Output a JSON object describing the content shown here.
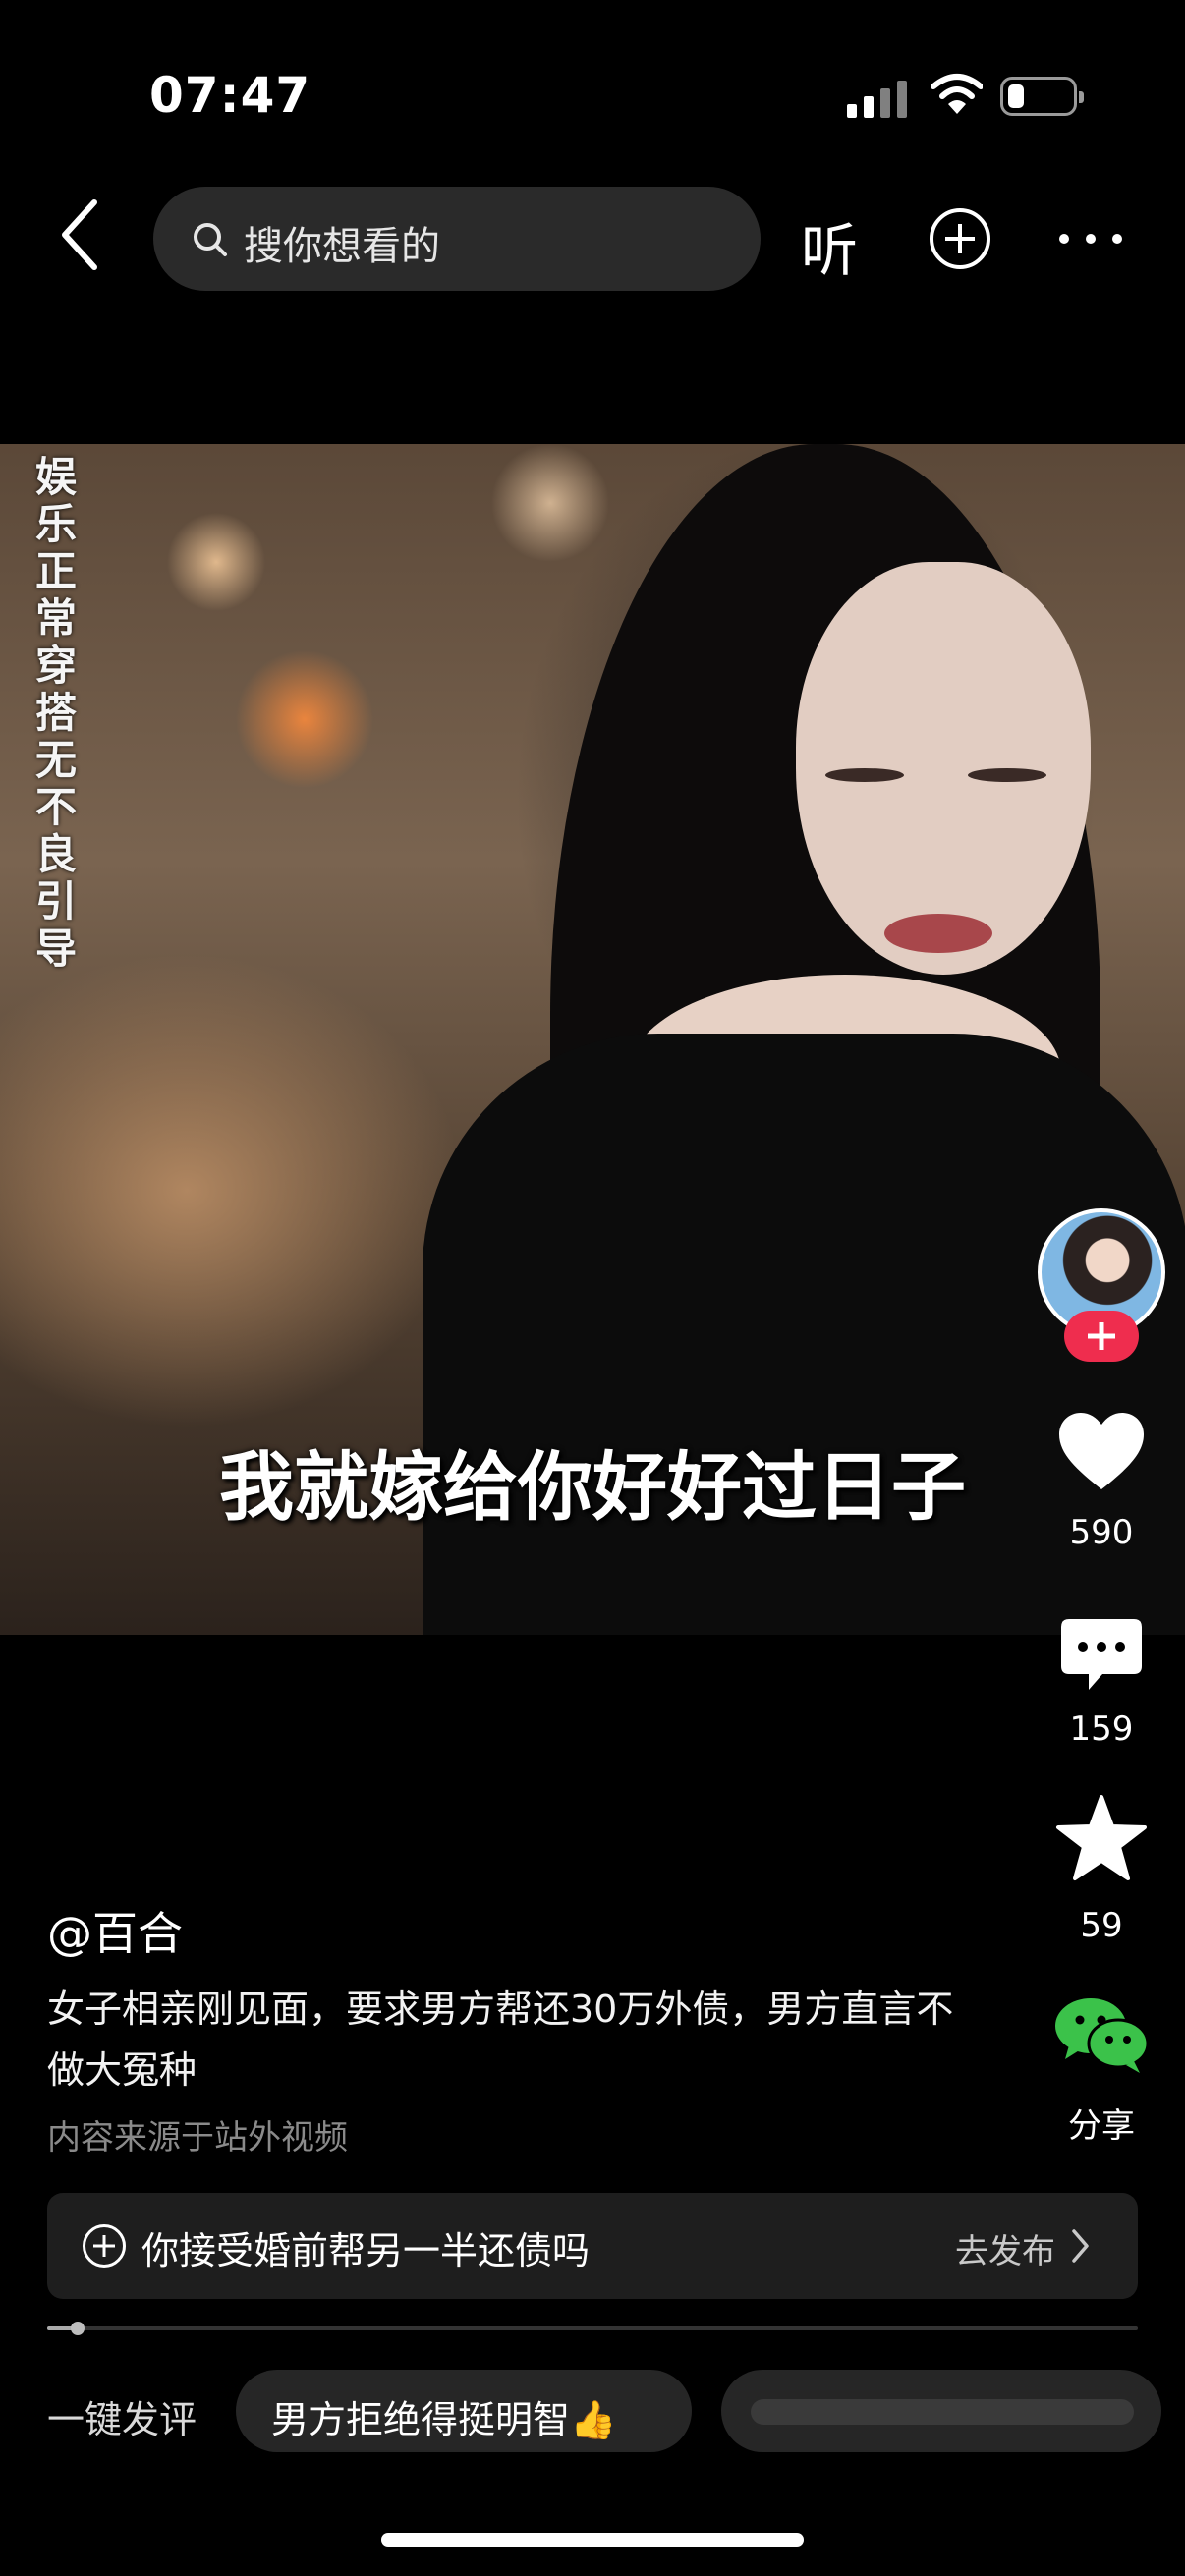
{
  "status_bar": {
    "time": "07:47"
  },
  "top_bar": {
    "search_placeholder": "搜你想看的",
    "listen_label": "听"
  },
  "video": {
    "vertical_caption": "娱乐 正常穿搭 无不良引导",
    "subtitle": "我就嫁给你好好过日子"
  },
  "rail": {
    "likes": "590",
    "comments": "159",
    "favorites": "59",
    "share_label": "分享"
  },
  "post": {
    "author": "@百合",
    "description": "女子相亲刚见面，要求男方帮还30万外债，男方直言不做大冤种",
    "source_note": "内容来源于站外视频"
  },
  "topic": {
    "text": "你接受婚前帮另一半还债吗",
    "action": "去发布"
  },
  "playback": {
    "progress_fraction": 0.028
  },
  "quick_comment": {
    "label": "一键发评",
    "chip1": "男方拒绝得挺明智👍"
  },
  "colors": {
    "follow_badge": "#ef2d4e",
    "share_green": "#3bc24a"
  }
}
